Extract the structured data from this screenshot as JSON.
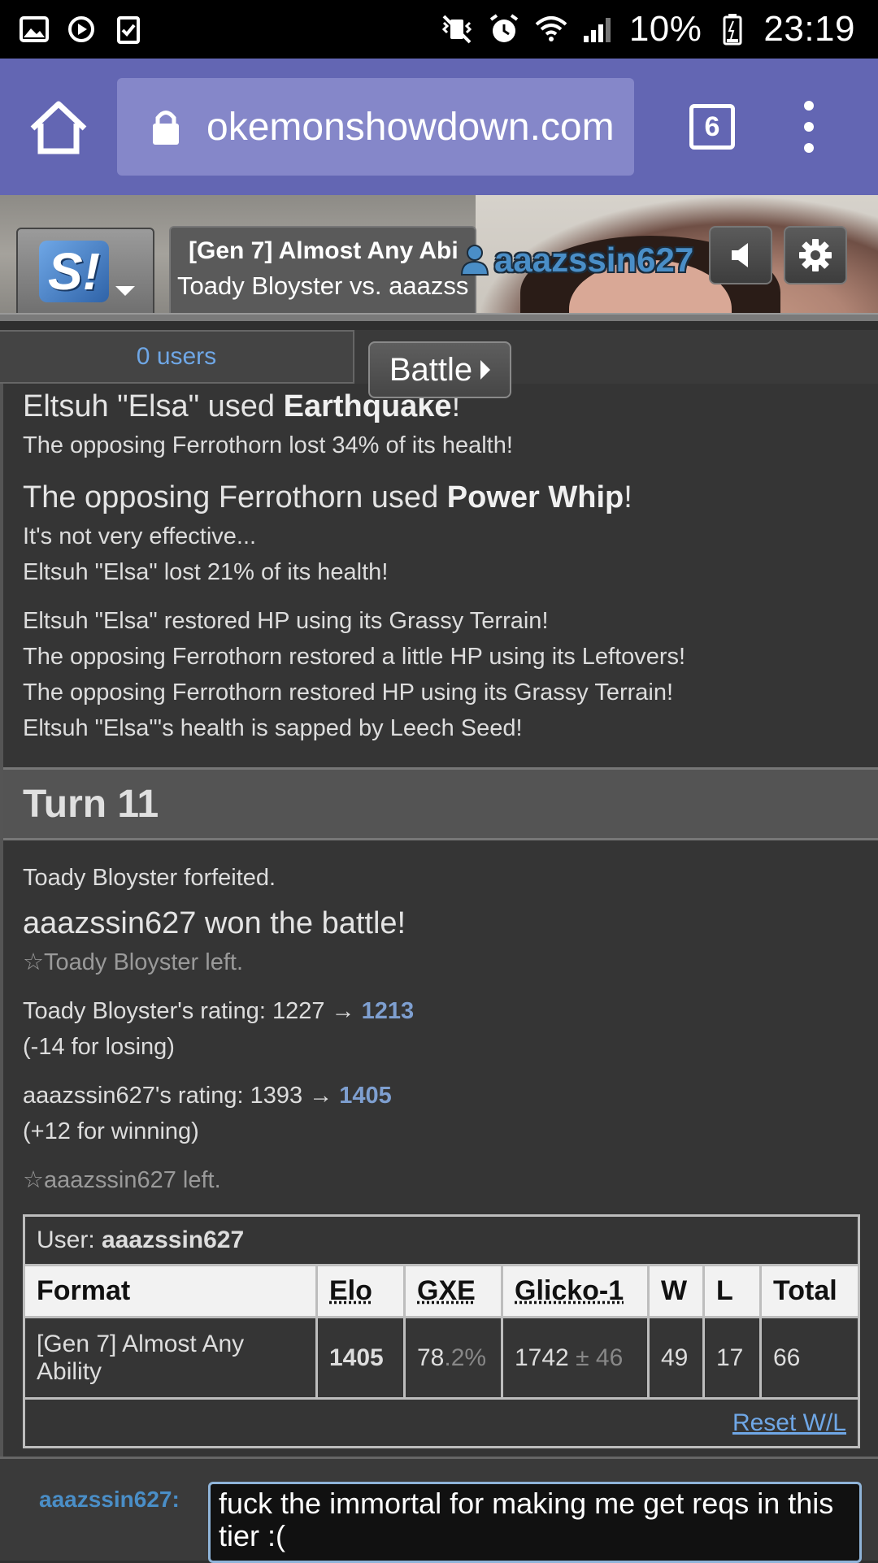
{
  "status_bar": {
    "left_icons": [
      "image-icon",
      "sync-icon",
      "clipboard-check-icon"
    ],
    "right_icons": [
      "vibrate-mute-icon",
      "alarm-icon",
      "wifi-icon",
      "signal-icon"
    ],
    "battery_percent": "10%",
    "time": "23:19"
  },
  "browser": {
    "url": "okemonshowdown.com",
    "tab_count": "6"
  },
  "showdown_header": {
    "logo_text": "S!",
    "tab_title": "[Gen 7] Almost Any Abi",
    "tab_subtitle": "Toady Bloyster vs. aaazss",
    "username": "aaazssin627"
  },
  "panel": {
    "users_label": "0 users",
    "battle_button": "Battle"
  },
  "log": {
    "line1_pre": "Eltsuh \"Elsa\" used ",
    "line1_move": "Earthquake",
    "line1_post": "!",
    "line2": "The opposing Ferrothorn lost 34% of its health!",
    "line3_pre": "The opposing Ferrothorn used ",
    "line3_move": "Power Whip",
    "line3_post": "!",
    "line4": "It's not very effective...",
    "line5": "Eltsuh \"Elsa\" lost 21% of its health!",
    "line6": "Eltsuh \"Elsa\" restored HP using its Grassy Terrain!",
    "line7": "The opposing Ferrothorn restored a little HP using its Leftovers!",
    "line8": "The opposing Ferrothorn restored HP using its Grassy Terrain!",
    "line9": "Eltsuh \"Elsa\"'s health is sapped by Leech Seed!",
    "turn": "Turn 11",
    "forfeit": "Toady Bloyster forfeited.",
    "winner": "aaazssin627 won the battle!",
    "left1": "☆Toady Bloyster left.",
    "rating1_pre": "Toady Bloyster's rating: 1227 → ",
    "rating1_new": "1213",
    "rating1_change": "(-14 for losing)",
    "rating2_pre": "aaazssin627's rating: 1393 → ",
    "rating2_new": "1405",
    "rating2_change": "(+12 for winning)",
    "left2": "☆aaazssin627 left."
  },
  "rating_table": {
    "user_label": "User: ",
    "user_name": "aaazssin627",
    "headers": [
      "Format",
      "Elo",
      "GXE",
      "Glicko-1",
      "W",
      "L",
      "Total"
    ],
    "row": {
      "format": "[Gen 7] Almost Any Ability",
      "elo": "1405",
      "gxe_main": "78",
      "gxe_dim": ".2%",
      "glicko_main": "1742",
      "glicko_dim": "± 46",
      "w": "49",
      "l": "17",
      "total": "66"
    },
    "reset_label": "Reset W/L"
  },
  "chat": {
    "name": "aaazssin627:",
    "input_value": "fuck the immortal for making me get reqs in this tier :("
  }
}
